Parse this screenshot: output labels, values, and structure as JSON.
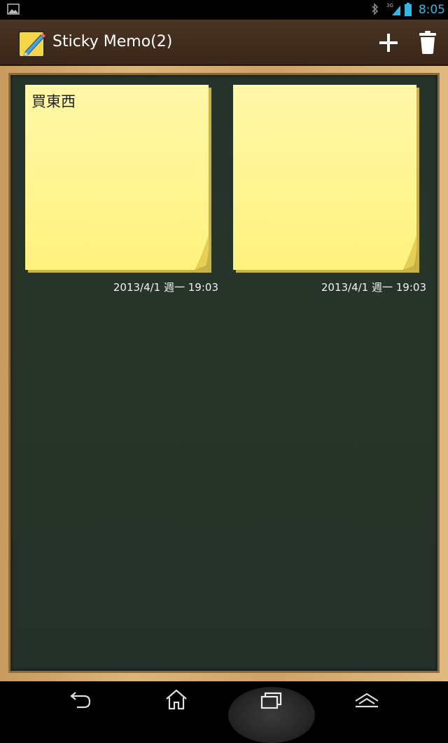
{
  "status_bar": {
    "clock": "8:05",
    "network_label": "3G",
    "icons": [
      "gallery-icon",
      "bluetooth-icon",
      "signal-icon",
      "battery-icon"
    ],
    "clock_color": "#33b5e5"
  },
  "action_bar": {
    "title": "Sticky Memo(2)",
    "icons": [
      "memo-app-icon",
      "add-icon",
      "trash-icon"
    ],
    "background": "#3f2c1d"
  },
  "notes": [
    {
      "text": "買東西",
      "date": "2013/4/1 週一 19:03"
    },
    {
      "text": "",
      "date": "2013/4/1 週一 19:03"
    }
  ],
  "board": {
    "color": "#27322a",
    "frame_color": "#d4a86c",
    "note_color": "#fff59d"
  },
  "nav_bar": {
    "icons": [
      "back-icon",
      "home-icon",
      "recent-apps-icon",
      "menu-up-icon"
    ]
  }
}
